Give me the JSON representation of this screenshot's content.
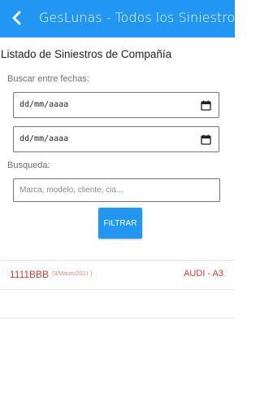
{
  "app_bar": {
    "title": "GesLunas - Todos los Siniestros",
    "back_icon": "chevron-left-icon",
    "color": "#2196f3"
  },
  "section": {
    "title": "Listado de Siniestros de Compañía"
  },
  "date_filter": {
    "label": "Buscar entre fechas:",
    "from_value": "dd/mm/aaaa",
    "to_value": "dd/mm/aaaa"
  },
  "search": {
    "label": "Busqueda:",
    "placeholder": "Marca, modelo, cliente, cia..."
  },
  "filter_button": {
    "label": "FILTRAR"
  },
  "claims": [
    {
      "plate": "1111BBB",
      "date": "(9/Marzo/2021 )",
      "vehicle": "AUDI - A3",
      "color": "#e53935"
    }
  ]
}
